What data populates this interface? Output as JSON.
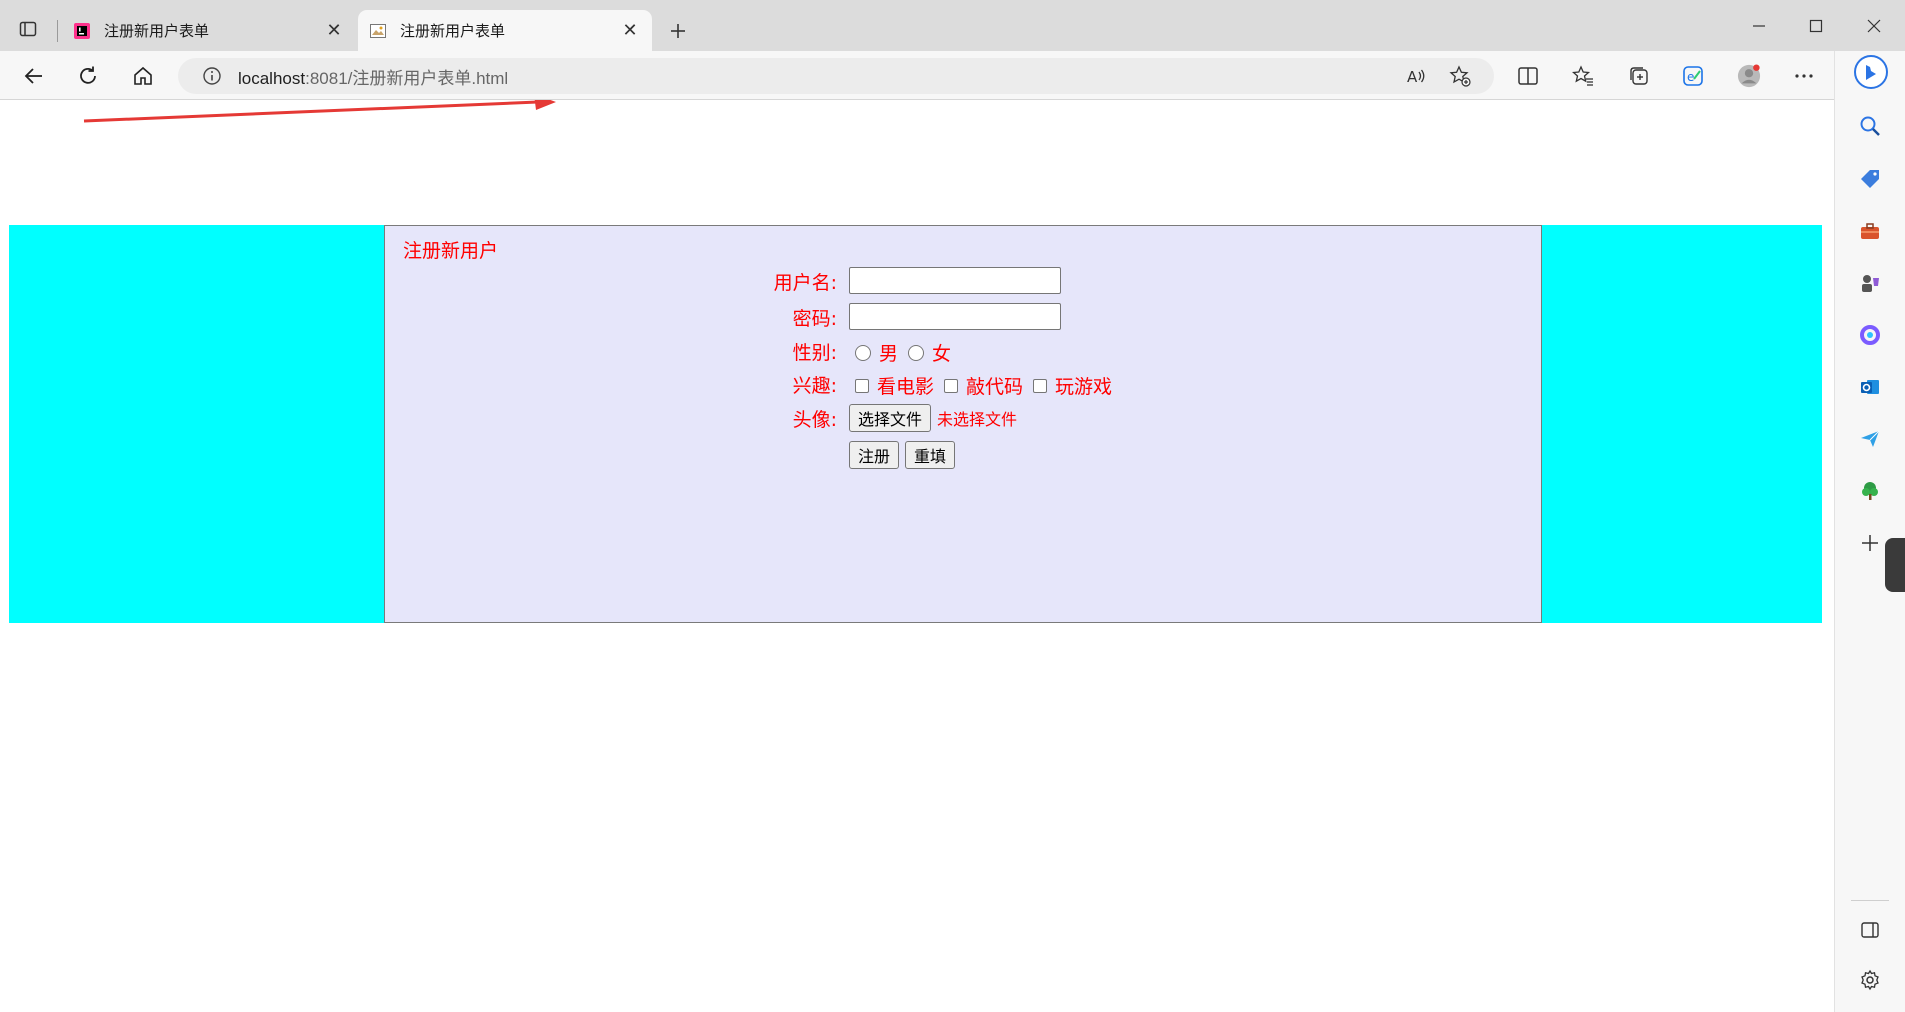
{
  "browser": {
    "tabs": [
      {
        "title": "注册新用户表单",
        "active": false
      },
      {
        "title": "注册新用户表单",
        "active": true
      }
    ],
    "address": {
      "host": "localhost",
      "rest": ":8081/注册新用户表单.html"
    },
    "icons": {
      "tab_actions": "tab-actions-icon",
      "close": "close-icon",
      "new_tab": "plus-icon",
      "back": "back-arrow-icon",
      "refresh": "refresh-icon",
      "home": "home-icon",
      "info": "info-icon",
      "read_aloud": "read-aloud-icon",
      "favorite_add": "favorite-add-icon",
      "split_screen": "split-screen-icon",
      "favorites": "favorites-icon",
      "collections": "collections-icon",
      "performance": "performance-icon",
      "profile": "profile-avatar-icon",
      "more": "more-dots-icon",
      "bing": "bing-copilot-icon"
    },
    "sidebar_icons": [
      "search-icon",
      "shopping-tag-icon",
      "tools-icon",
      "games-icon",
      "microsoft365-icon",
      "outlook-icon",
      "send-icon",
      "tree-icon",
      "add-icon",
      "sidebar-layout-icon",
      "settings-icon"
    ]
  },
  "page": {
    "colors": {
      "band": "#00ffff",
      "panel": "#e6e6fa",
      "text": "#ff0000",
      "arrow": "#e53935"
    },
    "form": {
      "title": "注册新用户",
      "username_label": "用户名:",
      "password_label": "密码:",
      "gender_label": "性别:",
      "gender_options": [
        "男",
        "女"
      ],
      "hobby_label": "兴趣:",
      "hobby_options": [
        "看电影",
        "敲代码",
        "玩游戏"
      ],
      "avatar_label": "头像:",
      "file_button": "选择文件",
      "file_status": "未选择文件",
      "submit": "注册",
      "reset": "重填"
    }
  }
}
